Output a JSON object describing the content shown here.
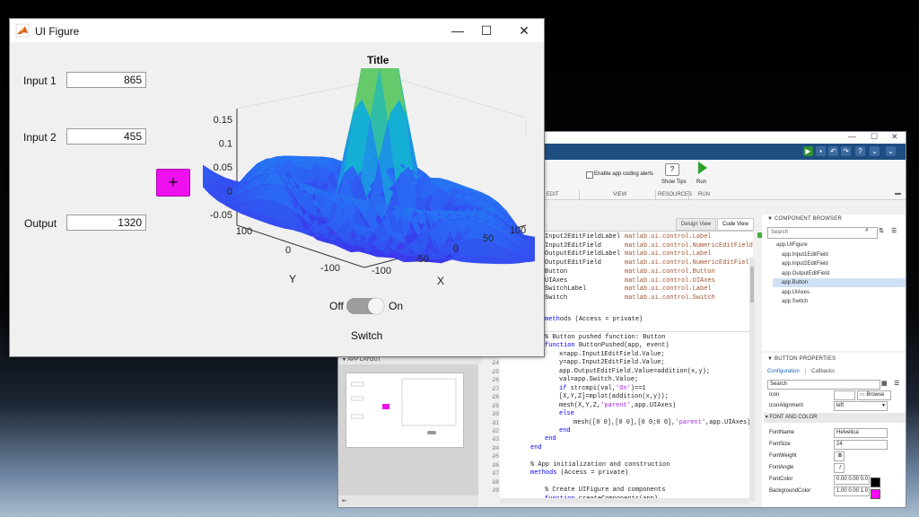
{
  "appdesigner": {
    "ribbon": {
      "alerts_checkbox": "Enable app coding alerts",
      "show_tips": "Show Tips",
      "run": "Run",
      "groups": [
        "EDIT",
        "VIEW",
        "RESOURCES",
        "RUN"
      ]
    },
    "view_tabs": [
      "Design View",
      "Code View"
    ],
    "properties_rows": [
      {
        "t": "Input2EditFieldLabel",
        "v": "matlab.ui.control.Label"
      },
      {
        "t": "Input2EditField",
        "v": "matlab.ui.control.NumericEditField"
      },
      {
        "t": "OutputEditFieldLabel",
        "v": "matlab.ui.control.Label"
      },
      {
        "t": "OutputEditField",
        "v": "matlab.ui.control.NumericEditField"
      },
      {
        "t": "Button",
        "v": "matlab.ui.control.Button"
      },
      {
        "t": "UIAxes",
        "v": "matlab.ui.control.UIAxes"
      },
      {
        "t": "SwitchLabel",
        "v": "matlab.ui.control.Label"
      },
      {
        "t": "Switch",
        "v": "matlab.ui.control.Switch"
      }
    ],
    "methods_line": "ods (Access = private)",
    "code_lines": [
      {
        "ln": "",
        "text": "% Button pushed function: Button",
        "cls": "cm",
        "indent": 8
      },
      {
        "ln": "",
        "text": "function ButtonPushed(app, event)",
        "cls": "kwfn",
        "indent": 8
      },
      {
        "ln": "23",
        "text": "x=app.Input1EditField.Value;",
        "cls": "",
        "indent": 16
      },
      {
        "ln": "24",
        "text": "y=app.Input2EditField.Value;",
        "cls": "",
        "indent": 16
      },
      {
        "ln": "25",
        "text": "app.OutputEditField.Value=addition(x,y);",
        "cls": "",
        "indent": 16
      },
      {
        "ln": "26",
        "text": "val=app.Switch.Value;",
        "cls": "",
        "indent": 16
      },
      {
        "ln": "27",
        "text": "if strcmpi(val,'On')==1",
        "cls": "",
        "indent": 16
      },
      {
        "ln": "28",
        "text": "[X,Y,Z]=mplot(addition(x,y));",
        "cls": "",
        "indent": 16
      },
      {
        "ln": "29",
        "text": "mesh(X,Y,Z,'parent',app.UIAxes)",
        "cls": "",
        "indent": 16
      },
      {
        "ln": "30",
        "text": "else",
        "cls": "",
        "indent": 16
      },
      {
        "ln": "31",
        "text": "mesh([0 0],[0 0],[0 0;0 0],'parent',app.UIAxes)",
        "cls": "",
        "indent": 24
      },
      {
        "ln": "32",
        "text": "end",
        "cls": "",
        "indent": 16
      },
      {
        "ln": "33",
        "text": "end",
        "cls": "",
        "indent": 8
      },
      {
        "ln": "34",
        "text": "end",
        "cls": "",
        "indent": 0
      },
      {
        "ln": "35",
        "text": "",
        "cls": "",
        "indent": 0
      },
      {
        "ln": "36",
        "text": "% App initialization and construction",
        "cls": "cm",
        "indent": 0
      },
      {
        "ln": "37",
        "text": "methods (Access = private)",
        "cls": "",
        "indent": 0
      },
      {
        "ln": "38",
        "text": "",
        "cls": "",
        "indent": 0
      },
      {
        "ln": "39",
        "text": "% Create UIFigure and components",
        "cls": "cm",
        "indent": 8
      },
      {
        "ln": "",
        "text": "function createComponents(app)",
        "cls": "",
        "indent": 8
      }
    ],
    "app_layout_header": "APP LAYOUT",
    "component_browser": {
      "header": "COMPONENT BROWSER",
      "search_placeholder": "Search",
      "items": [
        "app.UIFigure",
        "app.Input1EditField",
        "app.Input2EditField",
        "app.OutputEditField",
        "app.Button",
        "app.UIAxes",
        "app.Switch"
      ],
      "selected": "app.Button"
    },
    "button_properties": {
      "header": "BUTTON PROPERTIES",
      "tabs": [
        "Configuration",
        "Callbacks"
      ],
      "search_placeholder": "Search",
      "icon_label": "Icon",
      "browse": "Browse",
      "icon_alignment_label": "IconAlignment",
      "icon_alignment_value": "left",
      "section": "FONT AND COLOR",
      "rows": [
        {
          "label": "FontName",
          "value": "Helvetica"
        },
        {
          "label": "FontSize",
          "value": "24"
        },
        {
          "label": "FontWeight",
          "value": "B"
        },
        {
          "label": "FontAngle",
          "value": "I"
        },
        {
          "label": "FontColor",
          "value": "0.00 0.00 0.0"
        },
        {
          "label": "BackgroundColor",
          "value": "1.00 0.00 1.0"
        }
      ],
      "font_color_swatch": "#000000",
      "bg_color_swatch": "#ff00ff"
    }
  },
  "uifigure": {
    "title": "UI Figure",
    "input1": {
      "label": "Input 1",
      "value": "865"
    },
    "input2": {
      "label": "Input 2",
      "value": "455"
    },
    "output": {
      "label": "Output",
      "value": "1320"
    },
    "button_label": "+",
    "button_color": "#ee10ee",
    "plot_title": "Title",
    "switch": {
      "off": "Off",
      "on": "On",
      "label": "Switch",
      "state": "On"
    },
    "z_ticks": [
      "0.15",
      "0.1",
      "0.05",
      "0",
      "-0.05"
    ],
    "y_ticks": [
      "100",
      "0",
      "-100"
    ],
    "x_ticks": [
      "-100",
      "-50",
      "0",
      "50",
      "100"
    ],
    "y_label": "Y",
    "x_label": "X"
  },
  "colors": {
    "accent_blue": "#1d4e82",
    "surface_low": "#4a3cf0",
    "surface_high": "#f9e21c",
    "toggle_track": "#9d9d9d"
  }
}
